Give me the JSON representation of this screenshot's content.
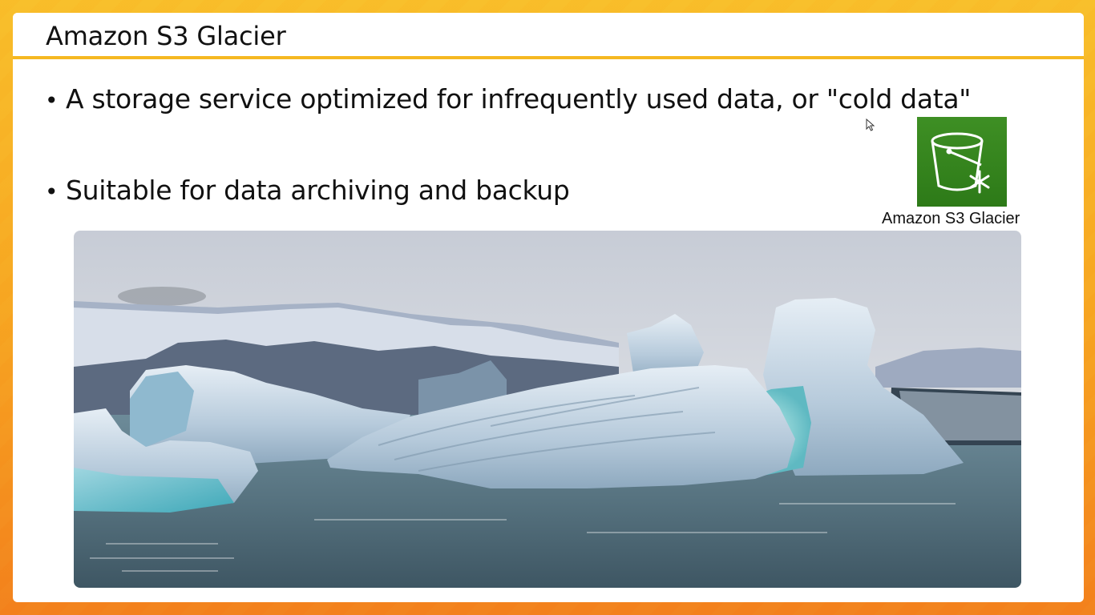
{
  "slide": {
    "title": "Amazon S3 Glacier",
    "bullets": [
      "A storage service optimized for infrequently used data, or \"cold data\"",
      "Suitable for data archiving and backup"
    ],
    "bullet_symbol": "•"
  },
  "service_icon": {
    "icon": "s3-glacier-bucket-snowflake-icon",
    "caption": "Amazon S3 Glacier",
    "color": "#3b8a1f"
  },
  "photo": {
    "subject": "icebergs-in-lagoon"
  },
  "colors": {
    "frame_orange": "#f7a21b",
    "title_underline": "#f5b822"
  }
}
